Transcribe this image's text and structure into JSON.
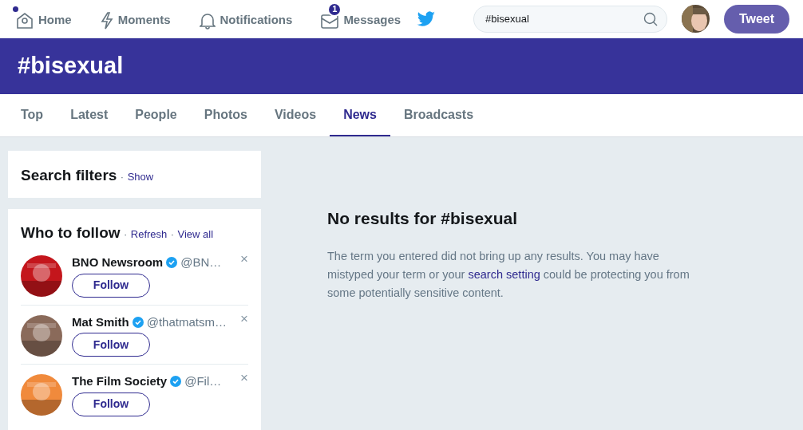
{
  "nav": {
    "items": [
      {
        "label": "Home",
        "unread": true
      },
      {
        "label": "Moments",
        "unread": false
      },
      {
        "label": "Notifications",
        "unread": false
      },
      {
        "label": "Messages",
        "unread": false,
        "badge": "1"
      }
    ],
    "search": {
      "value": "#bisexual"
    },
    "tweet_button": "Tweet"
  },
  "banner": {
    "title": "#bisexual"
  },
  "tabs": [
    {
      "label": "Top",
      "selected": false
    },
    {
      "label": "Latest",
      "selected": false
    },
    {
      "label": "People",
      "selected": false
    },
    {
      "label": "Photos",
      "selected": false
    },
    {
      "label": "Videos",
      "selected": false
    },
    {
      "label": "News",
      "selected": true
    },
    {
      "label": "Broadcasts",
      "selected": false
    }
  ],
  "search_filters": {
    "title": "Search filters",
    "separator": "·",
    "link": "Show"
  },
  "who_to_follow": {
    "title": "Who to follow",
    "links": [
      {
        "separator": "·",
        "label": "Refresh"
      },
      {
        "separator": "·",
        "label": "View all"
      }
    ],
    "accounts": [
      {
        "name": "BNO Newsroom",
        "verified": true,
        "handle": "@BN…",
        "button": "Follow",
        "close": "×"
      },
      {
        "name": "Mat Smith",
        "verified": true,
        "handle": "@thatmatsm…",
        "button": "Follow",
        "close": "×"
      },
      {
        "name": "The Film Society",
        "verified": true,
        "handle": "@Fil…",
        "button": "Follow",
        "close": "×"
      }
    ]
  },
  "results": {
    "title": "No results for #bisexual",
    "message": "The term you entered did not bring up any results. You may have mistyped your term or your ",
    "link": "search setting",
    "message_end": " could be protecting you from some potentially sensitive content."
  }
}
